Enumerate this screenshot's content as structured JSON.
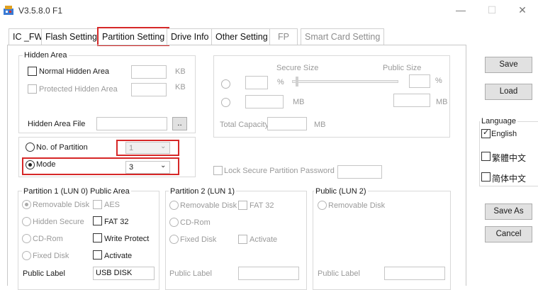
{
  "window": {
    "title": "V3.5.8.0 F1",
    "minimize": "—",
    "maximize": "☐",
    "close": "✕"
  },
  "tabs": [
    {
      "label": "IC _FW"
    },
    {
      "label": "Flash Setting"
    },
    {
      "label": "Partition Setting"
    },
    {
      "label": "Drive Info"
    },
    {
      "label": "Other Setting"
    },
    {
      "label": "FP"
    },
    {
      "label": "Smart Card Setting"
    }
  ],
  "hidden_area": {
    "group_label": "Hidden Area",
    "normal": {
      "label": "Normal Hidden Area",
      "value": "",
      "unit": "KB"
    },
    "protected": {
      "label": "Protected Hidden Area",
      "value": "",
      "unit": "KB"
    },
    "file": {
      "label": "Hidden Area File",
      "value": "",
      "browse": ".."
    }
  },
  "secure": {
    "secure_size_label": "Secure Size",
    "public_size_label": "Public Size",
    "percent": "%",
    "mb": "MB",
    "total_capacity_label": "Total Capacity",
    "total_unit": "MB"
  },
  "partition_mode": {
    "no_label": "No. of Partition",
    "no_value": "1",
    "mode_label": "Mode",
    "mode_value": "3"
  },
  "lock_password": {
    "label": "Lock Secure Partition Password",
    "value": ""
  },
  "partition1": {
    "group_label": "Partition 1 (LUN 0) Public Area",
    "removable": "Removable Disk",
    "aes": "AES",
    "hidden_secure": "Hidden Secure",
    "fat32": "FAT 32",
    "cdrom": "CD-Rom",
    "write_protect": "Write Protect",
    "fixed": "Fixed Disk",
    "activate": "Activate",
    "public_label": "Public Label",
    "public_value": "USB DISK"
  },
  "partition2": {
    "group_label": "Partition 2 (LUN 1)",
    "removable": "Removable Disk",
    "fat32": "FAT 32",
    "cdrom": "CD-Rom",
    "fixed": "Fixed Disk",
    "activate": "Activate",
    "public_label": "Public Label",
    "public_value": ""
  },
  "public_lun2": {
    "group_label": "Public (LUN 2)",
    "removable": "Removable Disk",
    "public_label": "Public Label",
    "public_value": ""
  },
  "side": {
    "save": "Save",
    "load": "Load",
    "language_label": "Language",
    "english": "English",
    "trad_chinese": "繁體中文",
    "simp_chinese": "简体中文",
    "save_as": "Save As",
    "cancel": "Cancel"
  },
  "colors": {
    "highlight": "#d62828",
    "button_face": "#e1e1e1"
  }
}
